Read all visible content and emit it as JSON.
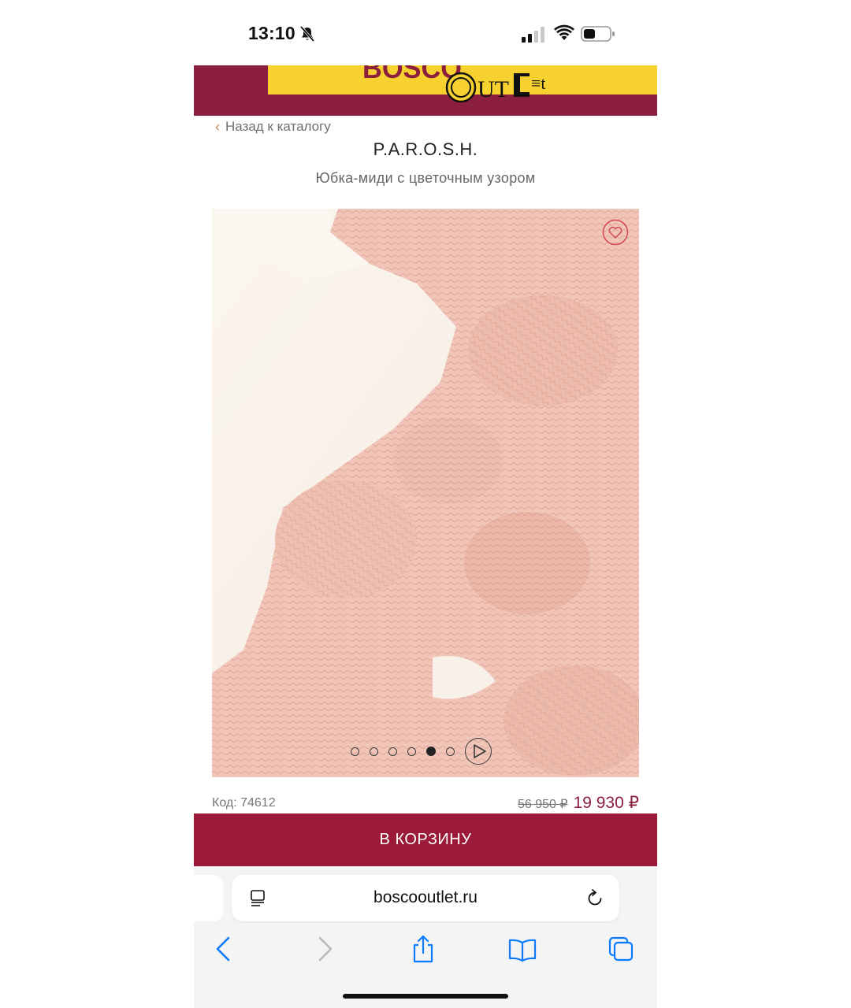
{
  "status_bar": {
    "time": "13:10"
  },
  "header": {
    "logo_text_top": "BOSCO",
    "logo_text_bottom": "OUTLet"
  },
  "nav": {
    "back_label": "Назад к каталогу"
  },
  "product": {
    "brand": "P.A.R.O.S.H.",
    "name": "Юбка-миди с цветочным узором",
    "code": "Код: 74612",
    "old_price": "56 950 ₽",
    "new_price": "19 930 ₽",
    "gallery_count": 6,
    "gallery_active_index": 4
  },
  "cart_button": {
    "label": "В КОРЗИНУ"
  },
  "browser": {
    "url": "boscooutlet.ru"
  },
  "colors": {
    "brand": "#8c1e3e",
    "button": "#9a1a37",
    "banner": "#f7d12f",
    "ios_blue": "#0a7aff"
  },
  "icons": {
    "status": [
      "bell-slash-icon",
      "signal-icon",
      "wifi-icon",
      "battery-icon"
    ],
    "gallery": [
      "heart-icon",
      "play-icon"
    ],
    "browser": [
      "reader-icon",
      "reload-icon",
      "back-icon",
      "forward-icon",
      "share-icon",
      "bookmarks-icon",
      "tabs-icon"
    ]
  }
}
